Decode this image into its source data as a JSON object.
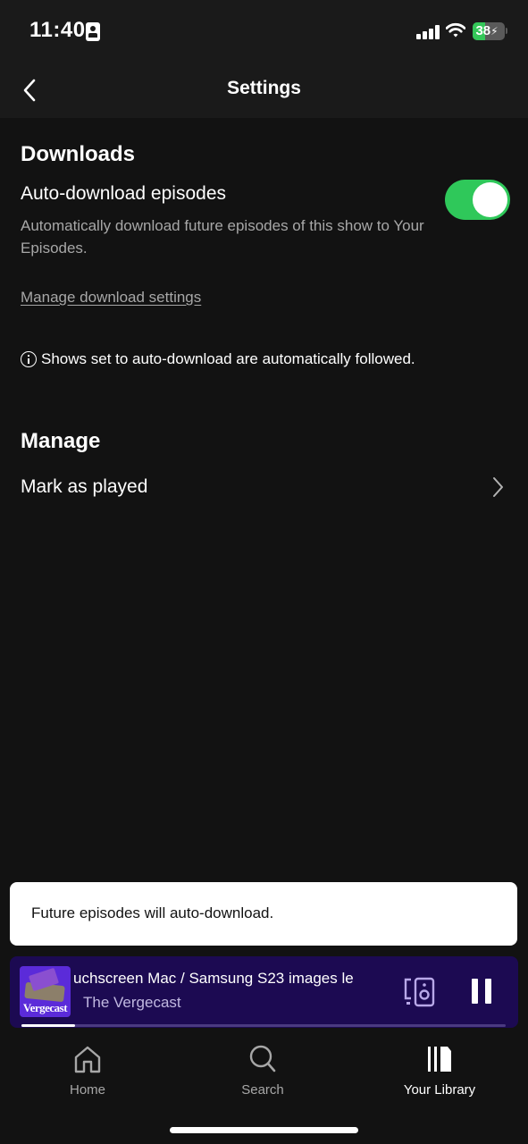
{
  "status_bar": {
    "time": "11:40",
    "battery_level": "38",
    "battery_percent": 38,
    "charging": true,
    "icons": [
      "id-card-icon",
      "signal-icon",
      "wifi-icon",
      "battery-icon"
    ]
  },
  "header": {
    "back_icon": "chevron-left-icon",
    "title": "Settings"
  },
  "downloads": {
    "section_title": "Downloads",
    "auto_download": {
      "label": "Auto-download episodes",
      "description": "Automatically download future episodes of this show to Your Episodes.",
      "enabled": true
    },
    "manage_link": "Manage download settings",
    "info_text": "Shows set to auto-download are automatically followed."
  },
  "manage": {
    "section_title": "Manage",
    "items": [
      {
        "label": "Mark as played",
        "icon": "chevron-right-icon"
      }
    ]
  },
  "toast": {
    "message": "Future episodes will auto-download."
  },
  "now_playing": {
    "artwork_label": "Vergecast",
    "title": "uchscreen Mac / Samsung S23 images le",
    "artist": "The Vergecast",
    "progress": 0.11,
    "device_icon": "devices-icon",
    "state_icon": "pause-icon"
  },
  "tabs": [
    {
      "label": "Home",
      "icon": "home-icon",
      "active": false
    },
    {
      "label": "Search",
      "icon": "search-icon",
      "active": false
    },
    {
      "label": "Your Library",
      "icon": "library-icon",
      "active": true
    }
  ],
  "colors": {
    "background": "#121212",
    "accent": "#1ed760",
    "player_background": "#1c0a52",
    "toast_background": "#ffffff"
  }
}
